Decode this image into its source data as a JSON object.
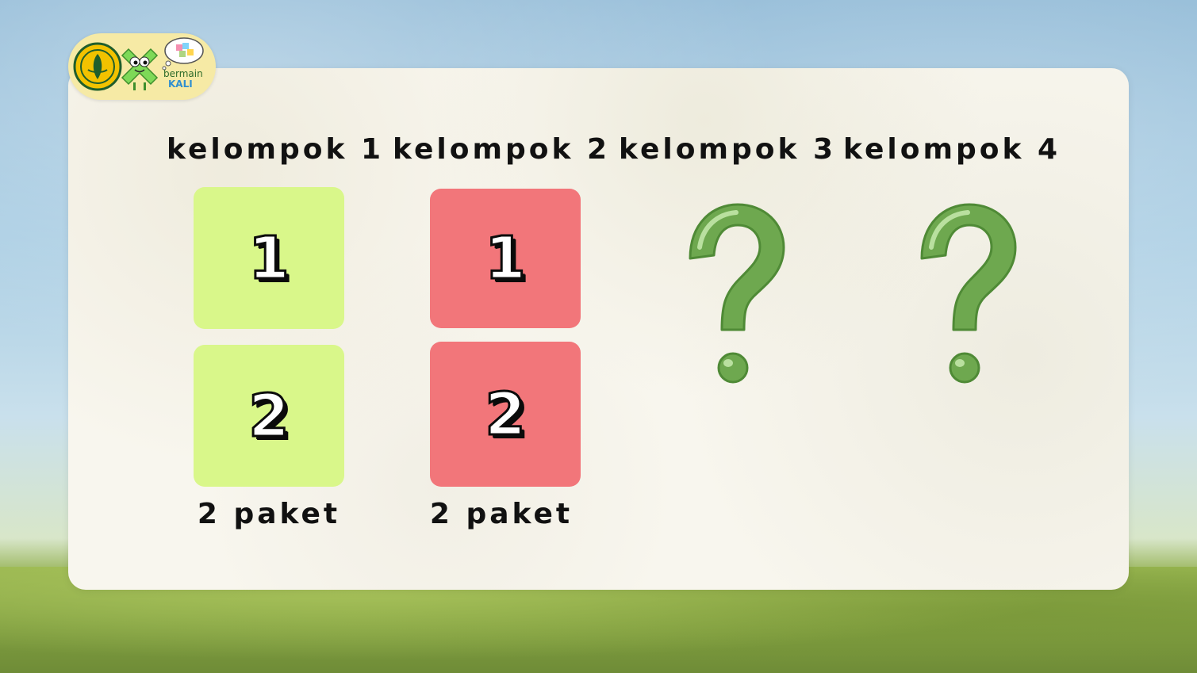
{
  "groups": [
    {
      "label": "kelompok 1",
      "tiles": [
        "1",
        "2"
      ],
      "caption": "2 paket"
    },
    {
      "label": "kelompok 2",
      "tiles": [
        "1",
        "2"
      ],
      "caption": "2 paket"
    },
    {
      "label": "kelompok 3"
    },
    {
      "label": "kelompok 4"
    }
  ],
  "logo": {
    "text_top": "bermain",
    "text_bottom": "KALI"
  },
  "colors": {
    "tile_green": "#d9f78a",
    "tile_red": "#f2767a",
    "question_mark": "#6ea84f",
    "badge": "#f6eaa5"
  },
  "icons": [
    "university-emblem-icon",
    "mascot-icon",
    "thought-bubble-icon",
    "question-mark-icon"
  ]
}
